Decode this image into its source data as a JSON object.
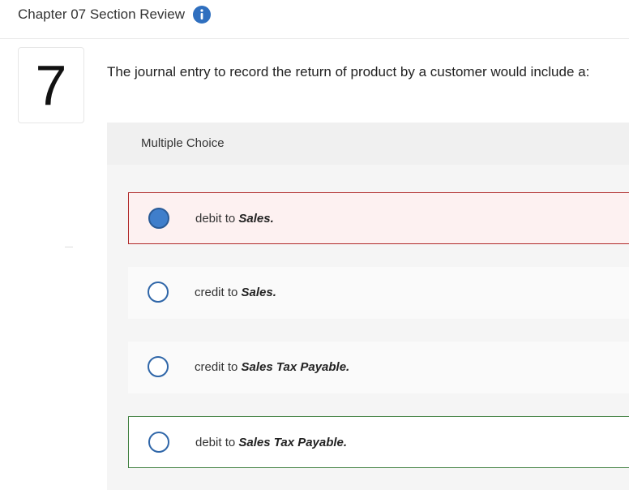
{
  "header": {
    "title": "Chapter 07 Section Review",
    "info_icon": "info-icon"
  },
  "question": {
    "number": "7",
    "text": "The journal entry to record the return of product by a customer would include a:"
  },
  "multiple_choice": {
    "label": "Multiple Choice",
    "choices": [
      {
        "prefix": "debit to ",
        "emphasis": "Sales.",
        "state": "selected"
      },
      {
        "prefix": "credit to ",
        "emphasis": "Sales.",
        "state": "default"
      },
      {
        "prefix": "credit to ",
        "emphasis": "Sales Tax Payable.",
        "state": "default"
      },
      {
        "prefix": "debit to ",
        "emphasis": "Sales Tax Payable.",
        "state": "correct"
      }
    ]
  },
  "colors": {
    "accent_blue": "#3f7ecb",
    "selected_border": "#b02a2a",
    "selected_bg": "#fdf1f1",
    "correct_border": "#3f7f3f"
  }
}
